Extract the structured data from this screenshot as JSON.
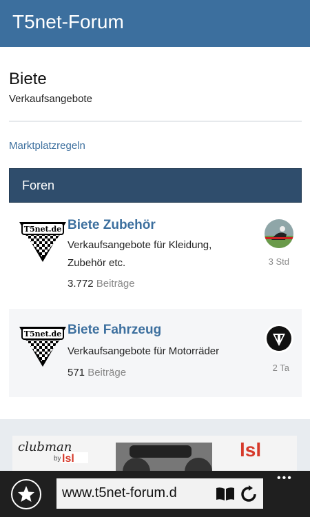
{
  "header": {
    "title": "T5net-Forum"
  },
  "page": {
    "title": "Biete",
    "subtitle": "Verkaufsangebote"
  },
  "link": {
    "label": "Marktplatzregeln"
  },
  "section": {
    "title": "Foren"
  },
  "forums": [
    {
      "title": "Biete Zubehör",
      "description": "Verkaufsangebote für Kleidung, Zubehör etc.",
      "count": "3.772",
      "count_label": "Beiträge",
      "time": "3 Std",
      "icon": "t5net-logo-icon",
      "avatar": "user-avatar-motorbike"
    },
    {
      "title": "Biete Fahrzeug",
      "description": "Verkaufsangebote für Motorräder",
      "count": "571",
      "count_label": "Beiträge",
      "time": "2 Ta",
      "icon": "t5net-logo-icon",
      "avatar": "user-avatar-triumph"
    }
  ],
  "browser": {
    "url": "www.t5net-forum.d",
    "more": "•••"
  },
  "colors": {
    "brand": "#3c6f9e",
    "section": "#2f4d6c",
    "browser": "#1f1f1f"
  }
}
